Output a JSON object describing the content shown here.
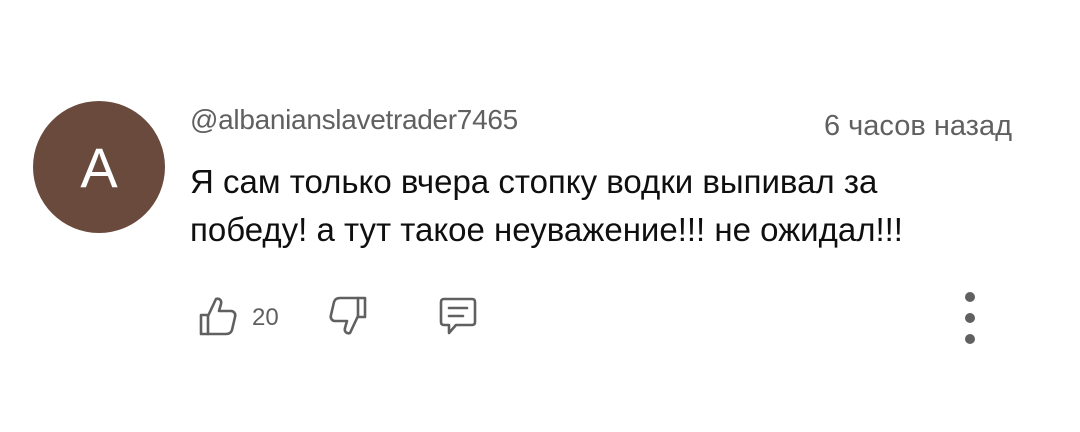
{
  "comment": {
    "avatar_letter": "A",
    "avatar_color": "#6b4a3e",
    "username": "@albanianslavetrader7465",
    "timestamp": "6 часов назад",
    "text_line1": "Я сам только вчера стопку водки выпивал за",
    "text_line2": "победу! а тут такое неуважение!!! не ожидал!!!",
    "like_count": "20",
    "icons": {
      "like": "thumbs-up-icon",
      "dislike": "thumbs-down-icon",
      "reply": "reply-comment-icon",
      "more": "more-vertical-icon"
    }
  }
}
